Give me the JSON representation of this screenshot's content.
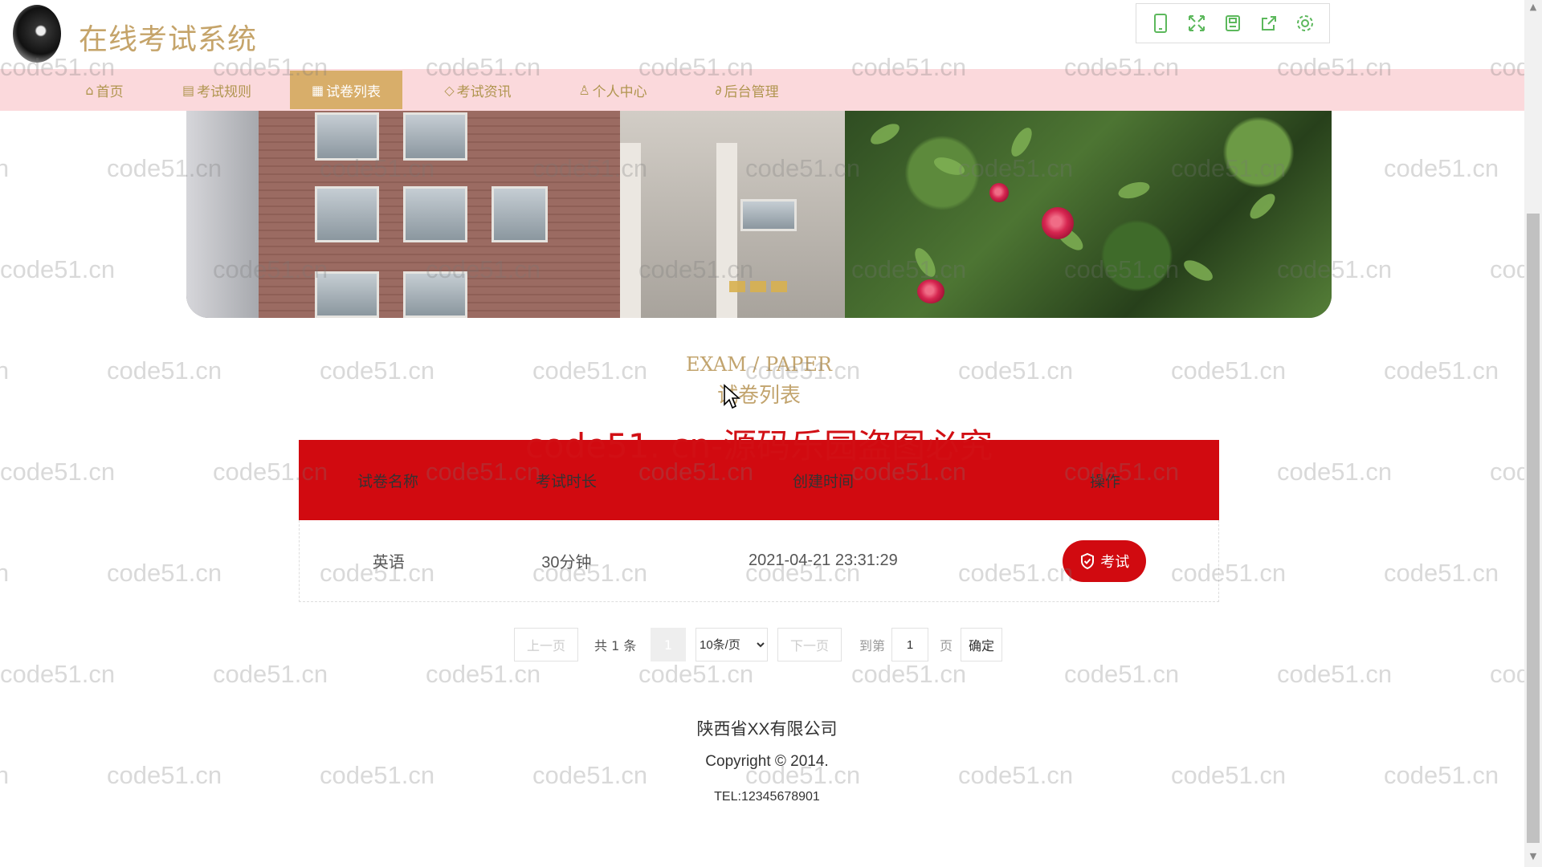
{
  "header": {
    "site_title": "在线考试系统",
    "tools": [
      "mobile-icon",
      "fullscreen-icon",
      "save-icon",
      "share-icon",
      "settings-icon"
    ]
  },
  "nav": {
    "items": [
      {
        "label": "首页",
        "icon": "home-icon"
      },
      {
        "label": "考试规则",
        "icon": "book-icon"
      },
      {
        "label": "试卷列表",
        "icon": "list-icon",
        "active": true
      },
      {
        "label": "考试资讯",
        "icon": "tag-icon"
      },
      {
        "label": "个人中心",
        "icon": "user-icon"
      },
      {
        "label": "后台管理",
        "icon": "link-icon"
      }
    ]
  },
  "section": {
    "title_en": "EXAM / PAPER",
    "title_cn": "试卷列表"
  },
  "overlay_watermark": "code51. cn-源码乐园盗图必究",
  "watermark_text": "code51.cn",
  "table": {
    "headers": [
      "试卷名称",
      "考试时长",
      "创建时间",
      "操作"
    ],
    "rows": [
      {
        "name": "英语",
        "duration": "30分钟",
        "created": "2021-04-21 23:31:29",
        "action": "考试"
      }
    ]
  },
  "pagination": {
    "prev": "上一页",
    "total": "共 1 条",
    "current_page": "1",
    "page_size": "10条/页",
    "page_size_options": [
      "10条/页"
    ],
    "next": "下一页",
    "goto_label": "到第",
    "goto_value": "1",
    "page_unit": "页",
    "confirm": "确定"
  },
  "footer": {
    "company": "陕西省XX有限公司",
    "copyright": "Copyright © 2014.",
    "tel": "TEL:12345678901"
  },
  "colors": {
    "accent_gold": "#c5a46a",
    "nav_bg": "#fbd9dc",
    "nav_active": "#d8ae6a",
    "primary_red": "#d10a10"
  }
}
